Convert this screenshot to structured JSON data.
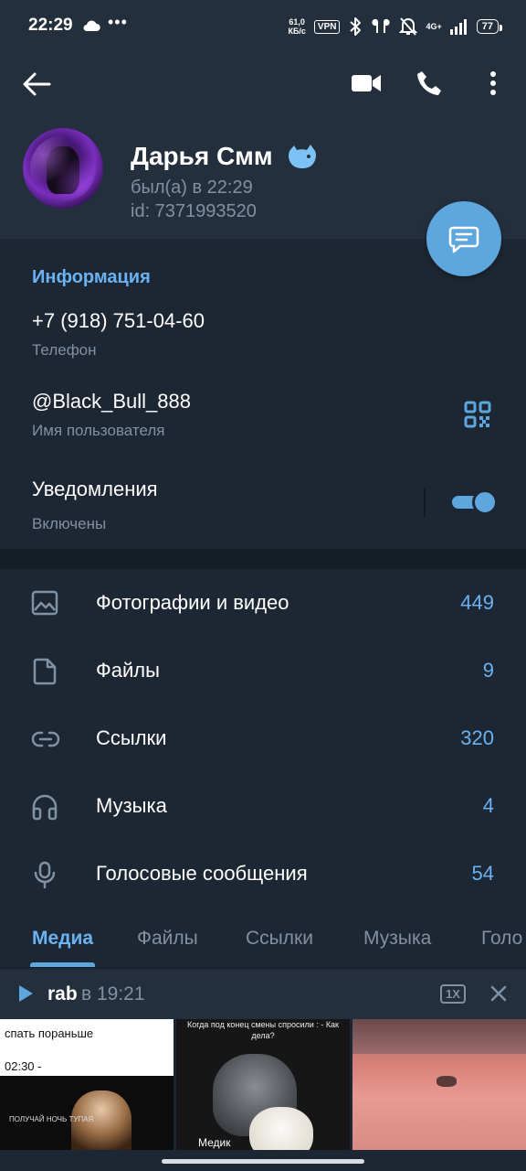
{
  "status_bar": {
    "time": "22:29",
    "dots": "•••",
    "speed_value": "61,0",
    "speed_unit": "КБ/с",
    "vpn": "VPN",
    "network": "4G+",
    "battery": "77"
  },
  "header": {
    "name": "Дарья Смм",
    "last_seen": "был(а) в 22:29",
    "user_id": "id: 7371993520"
  },
  "info": {
    "section_title": "Информация",
    "phone": "+7 (918) 751-04-60",
    "phone_label": "Телефон",
    "username": "@Black_Bull_888",
    "username_label": "Имя пользователя",
    "notifications": "Уведомления",
    "notifications_state": "Включены"
  },
  "media_list": [
    {
      "icon": "photo-icon",
      "label": "Фотографии и видео",
      "count": "449"
    },
    {
      "icon": "file-icon",
      "label": "Файлы",
      "count": "9"
    },
    {
      "icon": "link-icon",
      "label": "Ссылки",
      "count": "320"
    },
    {
      "icon": "headphones-icon",
      "label": "Музыка",
      "count": "4"
    },
    {
      "icon": "microphone-icon",
      "label": "Голосовые сообщения",
      "count": "54"
    }
  ],
  "tabs": [
    "Медиа",
    "Файлы",
    "Ссылки",
    "Музыка",
    "Голо"
  ],
  "player": {
    "title": "rab",
    "time": "в 19:21",
    "speed": "1X"
  },
  "media_grid": {
    "item1_text1": "спать пораньше",
    "item1_text2": "02:30 -",
    "item1_text3": "ПОЛУЧАЙ НОЧЬ ТУПАЯ",
    "item2_caption": "Когда под конец смены спросили : - Как дела?",
    "item2_label": "Медик"
  },
  "colors": {
    "accent": "#6ab2f2",
    "background": "#1d2733",
    "header": "#242f3d",
    "secondary_text": "#7f91a4"
  }
}
